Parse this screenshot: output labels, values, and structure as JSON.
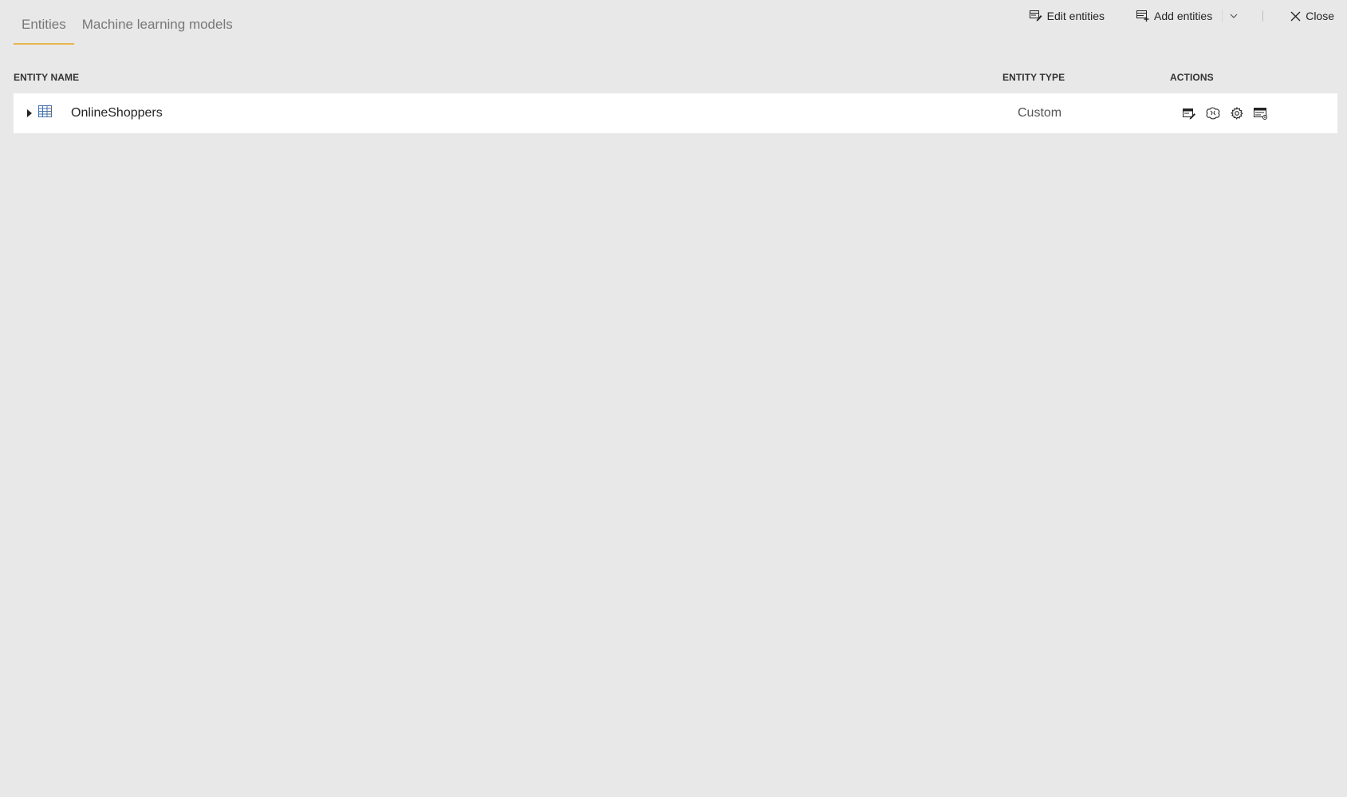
{
  "tabs": [
    {
      "label": "Entities",
      "active": true
    },
    {
      "label": "Machine learning models",
      "active": false
    }
  ],
  "toolbar": {
    "edit_label": "Edit entities",
    "add_label": "Add entities",
    "close_label": "Close"
  },
  "table": {
    "headers": {
      "name": "ENTITY NAME",
      "type": "ENTITY TYPE",
      "actions": "ACTIONS"
    },
    "rows": [
      {
        "name": "OnlineShoppers",
        "type": "Custom",
        "actions": [
          "edit-entity-icon",
          "ai-insights-icon",
          "settings-gear-icon",
          "properties-icon"
        ]
      }
    ]
  },
  "colors": {
    "background": "#e8e8e8",
    "row": "#ffffff",
    "accent": "#e8b54e",
    "tab_text": "#777777"
  }
}
